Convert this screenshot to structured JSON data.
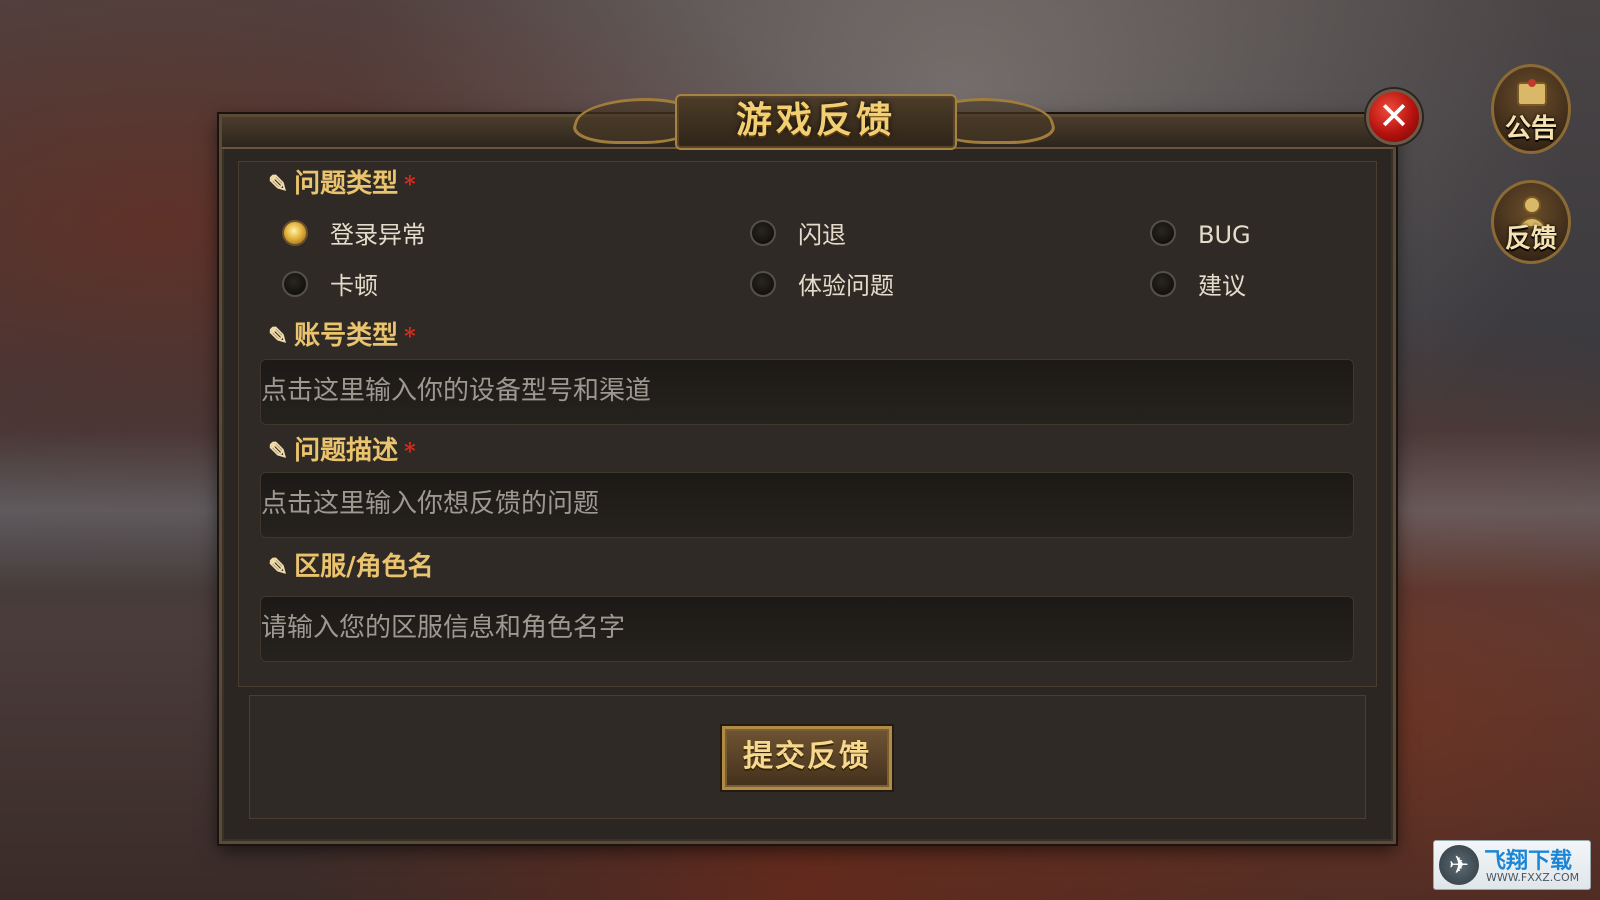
{
  "dialog": {
    "title": "游戏反馈",
    "close_symbol": "✕"
  },
  "side_buttons": {
    "notice": {
      "label": "公告",
      "icon": "scroll-icon"
    },
    "feedback": {
      "label": "反馈",
      "icon": "person-icon"
    }
  },
  "form": {
    "problem_type": {
      "label": "问题类型",
      "required_mark": "*",
      "options": [
        {
          "label": "登录异常",
          "selected": true
        },
        {
          "label": "闪退",
          "selected": false
        },
        {
          "label": "BUG",
          "selected": false
        },
        {
          "label": "卡顿",
          "selected": false
        },
        {
          "label": "体验问题",
          "selected": false
        },
        {
          "label": "建议",
          "selected": false
        }
      ]
    },
    "account_type": {
      "label": "账号类型",
      "required_mark": "*",
      "placeholder": "点击这里输入你的设备型号和渠道"
    },
    "description": {
      "label": "问题描述",
      "required_mark": "*",
      "placeholder": "点击这里输入你想反馈的问题"
    },
    "server_role": {
      "label": "区服/角色名",
      "placeholder": "请输入您的区服信息和角色名字"
    },
    "submit_label": "提交反馈"
  },
  "watermark": {
    "name": "飞翔下载",
    "url": "WWW.FXXZ.COM"
  },
  "colors": {
    "accent_gold": "#e9c36d",
    "required_red": "#e02a1a",
    "panel_bg": "#2b2622"
  }
}
